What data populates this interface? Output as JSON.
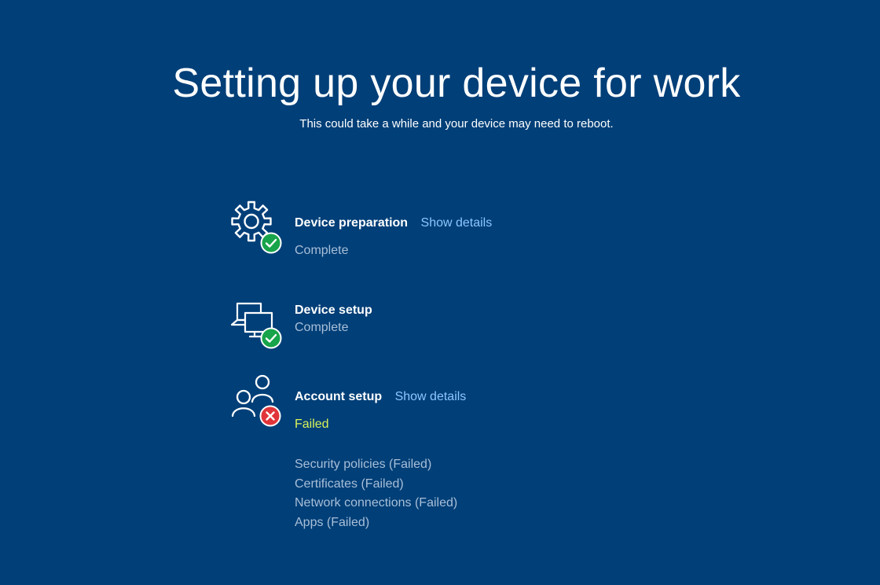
{
  "header": {
    "title": "Setting up your device for work",
    "subtitle": "This could take a while and your device may need to reboot."
  },
  "colors": {
    "background": "#003f78",
    "link": "#8ec6ff",
    "status_muted": "#a9bfd8",
    "status_failed": "#d9f25a",
    "success_badge": "#17a44a",
    "error_badge": "#e0343a"
  },
  "steps": [
    {
      "icon": "gear-icon",
      "badge": "check-badge-icon",
      "name": "Device preparation",
      "link": "Show details",
      "status": "Complete"
    },
    {
      "icon": "devices-icon",
      "badge": "check-badge-icon",
      "name": "Device setup",
      "status": "Complete"
    },
    {
      "icon": "people-icon",
      "badge": "error-badge-icon",
      "name": "Account setup",
      "link": "Show details",
      "status": "Failed",
      "details": [
        "Security policies (Failed)",
        "Certificates (Failed)",
        "Network connections (Failed)",
        "Apps (Failed)"
      ]
    }
  ]
}
